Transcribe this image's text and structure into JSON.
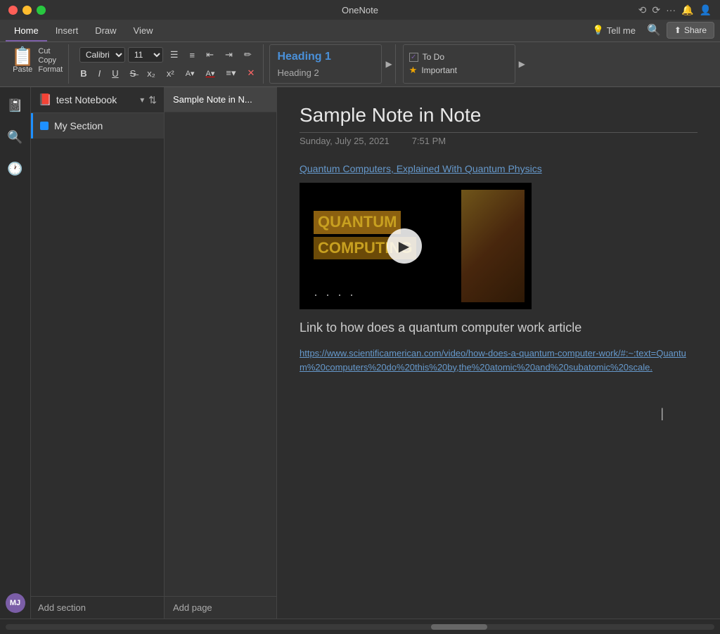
{
  "app": {
    "title": "OneNote"
  },
  "titlebar": {
    "title": "OneNote",
    "share_label": "Share",
    "history_label": "⟲",
    "redo_label": "⟳",
    "more_label": "···"
  },
  "ribbon": {
    "tabs": [
      "Home",
      "Insert",
      "Draw",
      "View"
    ],
    "active_tab": "Home",
    "tell_me": "Tell me",
    "share": "Share"
  },
  "toolbar": {
    "paste_label": "Paste",
    "cut_label": "Cut",
    "copy_label": "Copy",
    "format_label": "Format",
    "font_family": "Calibri",
    "font_size": "11",
    "bold": "B",
    "italic": "I",
    "underline": "U",
    "strikethrough": "S",
    "subscript": "x₂",
    "superscript": "x²",
    "heading1": "Heading 1",
    "heading2": "Heading 2",
    "tag_todo": "To Do",
    "tag_important": "Important"
  },
  "sidebar": {
    "notebook_icon": "📓",
    "search_icon": "🔍",
    "recent_icon": "🕐"
  },
  "notebook": {
    "name": "test Notebook",
    "icon": "📕",
    "sections": [
      {
        "label": "My Section",
        "color": "#1e90ff"
      }
    ],
    "add_section_label": "Add section"
  },
  "pages": {
    "items": [
      {
        "label": "Sample Note in N...",
        "active": true
      }
    ],
    "add_page_label": "Add page"
  },
  "note": {
    "title": "Sample Note in Note",
    "date": "Sunday, July 25, 2021",
    "time": "7:51 PM",
    "link_text": "Quantum Computers, Explained With Quantum Physics",
    "video_title_line1": "QUANTUM",
    "video_title_line2": "COMPUTING",
    "article_heading": "Link to how does a quantum computer work article",
    "article_url": "https://www.scientificamerican.com/video/how-does-a-quantum-computer-work/#:~:text=Quantum%20computers%20do%20this%20by,the%20atomic%20and%20subatomic%20scale."
  },
  "user": {
    "initials": "MJ"
  }
}
